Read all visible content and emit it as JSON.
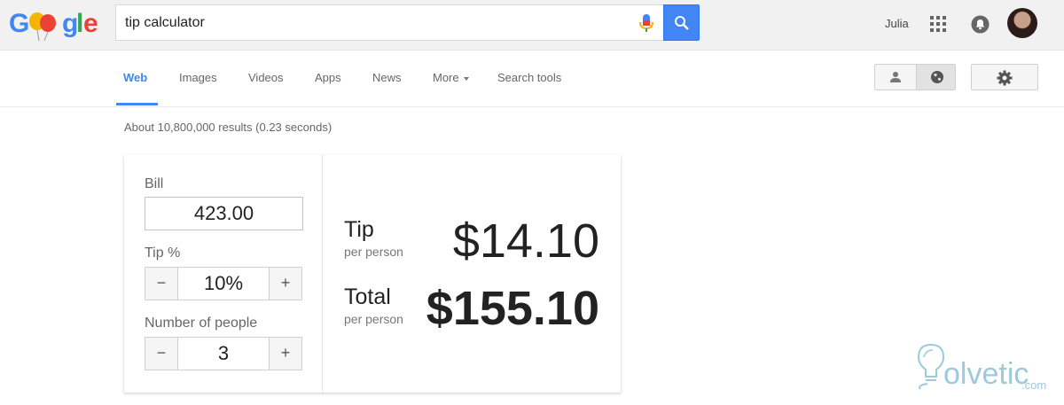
{
  "header": {
    "logo_text": "Google",
    "search_value": "tip calculator",
    "user_name": "Julia"
  },
  "nav": {
    "tabs": [
      {
        "label": "Web",
        "active": true
      },
      {
        "label": "Images"
      },
      {
        "label": "Videos"
      },
      {
        "label": "Apps"
      },
      {
        "label": "News"
      },
      {
        "label": "More"
      },
      {
        "label": "Search tools"
      }
    ]
  },
  "results": {
    "stats": "About 10,800,000 results (0.23 seconds)"
  },
  "calculator": {
    "bill_label": "Bill",
    "bill_value": "423.00",
    "tip_label": "Tip %",
    "tip_value": "10%",
    "people_label": "Number of people",
    "people_value": "3",
    "minus": "−",
    "plus": "+",
    "tip_title": "Tip",
    "tip_sub": "per person",
    "tip_amount": "$14.10",
    "total_title": "Total",
    "total_sub": "per person",
    "total_amount": "$155.10"
  },
  "watermark": {
    "text": "olvetic",
    "suffix": ".com"
  },
  "colors": {
    "accent": "#4285f4",
    "watermark": "#9ec9dd"
  }
}
